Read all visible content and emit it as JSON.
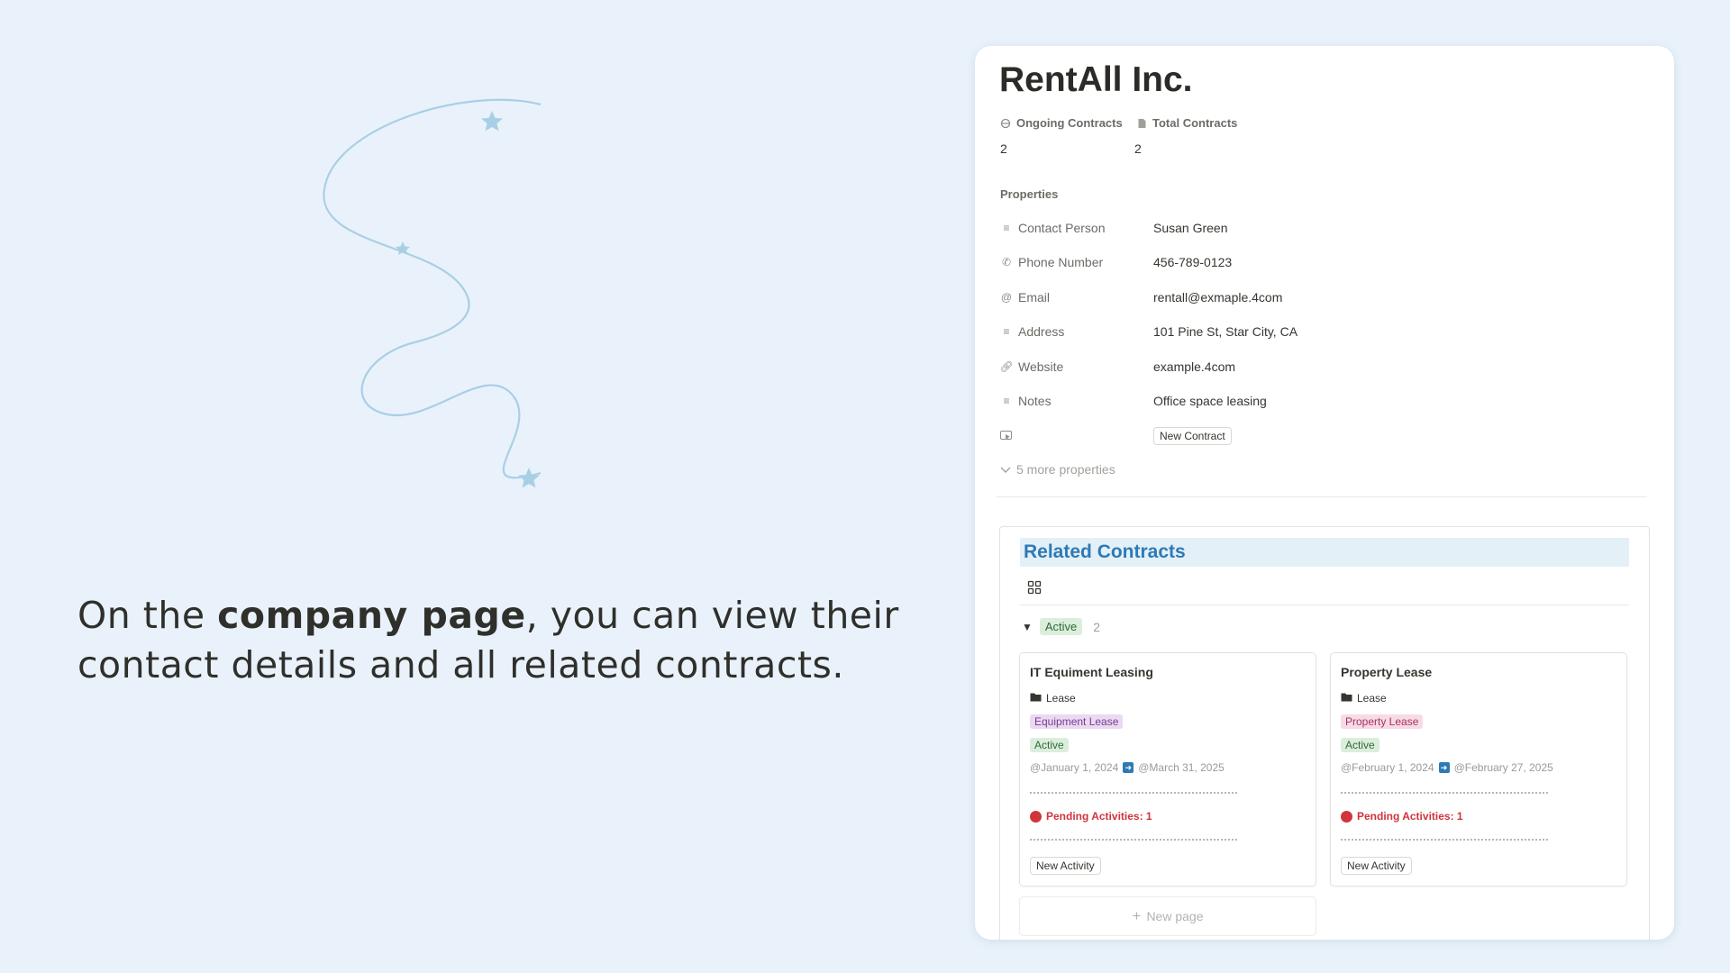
{
  "tagline": {
    "prefix": "On the ",
    "bold": "company page",
    "suffix_line1": ", you can view their",
    "line2": "contact details and all related contracts."
  },
  "company": {
    "name": "RentAll Inc.",
    "stats": [
      {
        "label": "Ongoing Contracts",
        "value": "2",
        "icon": "loop-icon"
      },
      {
        "label": "Total Contracts",
        "value": "2",
        "icon": "document-icon"
      }
    ],
    "properties_label": "Properties",
    "properties": [
      {
        "label": "Contact Person",
        "value": "Susan Green",
        "icon": "text-lines-icon"
      },
      {
        "label": "Phone Number",
        "value": "456-789-0123",
        "icon": "phone-icon"
      },
      {
        "label": "Email",
        "value": "rentall@exmaple.4com",
        "icon": "at-icon"
      },
      {
        "label": "Address",
        "value": "101 Pine St, Star City, CA",
        "icon": "text-lines-icon"
      },
      {
        "label": "Website",
        "value": "example.4com",
        "icon": "link-icon"
      },
      {
        "label": "Notes",
        "value": "Office space leasing",
        "icon": "text-lines-icon"
      }
    ],
    "button_property": {
      "icon": "cursor-click-icon",
      "label": "New Contract"
    },
    "more_properties": "5 more properties"
  },
  "related": {
    "title": "Related Contracts",
    "group": {
      "label": "Active",
      "count": "2"
    },
    "cards": [
      {
        "title": "IT Equiment Leasing",
        "type": "Lease",
        "subtag": "Equipment Lease",
        "subtag_bg": "#ead9f0",
        "subtag_color": "#7a3b95",
        "status": "Active",
        "start": "@January 1, 2024",
        "end": "@March 31, 2025",
        "pending": "Pending Activities: 1",
        "button": "New Activity"
      },
      {
        "title": "Property Lease",
        "type": "Lease",
        "subtag": "Property Lease",
        "subtag_bg": "#f6dbe6",
        "subtag_color": "#a8325e",
        "status": "Active",
        "start": "@February 1, 2024",
        "end": "@February 27, 2025",
        "pending": "Pending Activities: 1",
        "button": "New Activity"
      }
    ],
    "new_page": "New page"
  }
}
